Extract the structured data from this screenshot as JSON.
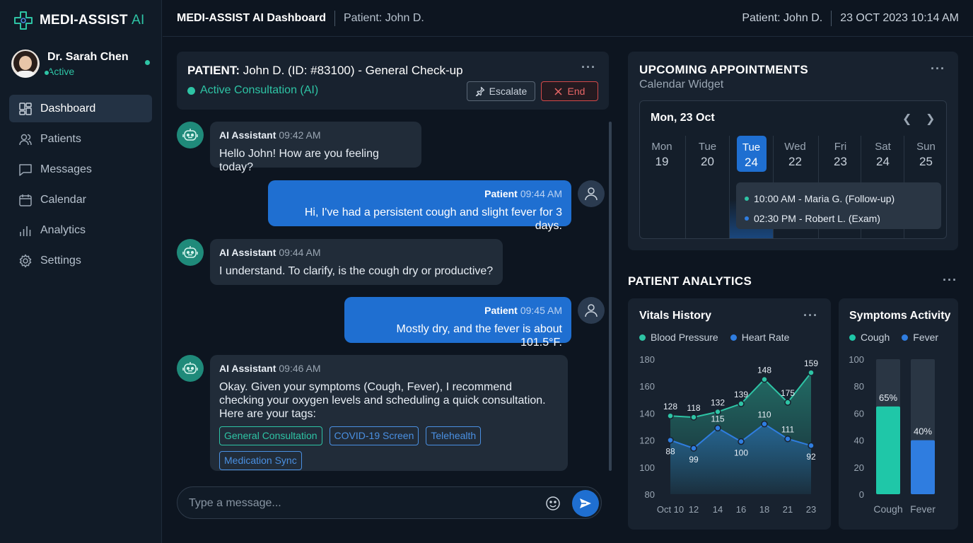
{
  "app": {
    "name": "MEDI-ASSIST",
    "name_suffix": "AI"
  },
  "user": {
    "name": "Dr. Sarah Chen",
    "status": "Active"
  },
  "nav": [
    {
      "label": "Dashboard",
      "icon": "dashboard-icon",
      "active": true
    },
    {
      "label": "Patients",
      "icon": "patients-icon"
    },
    {
      "label": "Messages",
      "icon": "messages-icon"
    },
    {
      "label": "Calendar",
      "icon": "calendar-icon"
    },
    {
      "label": "Analytics",
      "icon": "analytics-icon"
    },
    {
      "label": "Settings",
      "icon": "settings-icon"
    }
  ],
  "topbar": {
    "title": "MEDI-ASSIST AI Dashboard",
    "patient": "Patient: John D.",
    "right_patient": "Patient: John D.",
    "datetime": "23 OCT 2023 10:14 AM"
  },
  "chat": {
    "header_label": "PATIENT:",
    "header_title": "John D. (ID: #83100) - General Check-up",
    "status": "Active Consultation (AI)",
    "escalate_label": "Escalate",
    "end_label": "End",
    "messages": [
      {
        "sender": "AI Assistant",
        "time": "09:42 AM",
        "text": "Hello John! How are you feeling today?"
      },
      {
        "sender": "Patient",
        "time": "09:44 AM",
        "text": "Hi, I've had a persistent cough and slight fever for 3 days."
      },
      {
        "sender": "AI Assistant",
        "time": "09:44 AM",
        "text": "I understand. To clarify, is the cough dry or productive?"
      },
      {
        "sender": "Patient",
        "time": "09:45 AM",
        "text": "Mostly dry, and the fever is about 101.5°F."
      },
      {
        "sender": "AI Assistant",
        "time": "09:46 AM",
        "text": "Okay. Given your symptoms (Cough, Fever), I recommend checking your oxygen levels and scheduling a quick consultation. Here are your tags:"
      }
    ],
    "tags": [
      "General Consultation",
      "COVID-19 Screen",
      "Telehealth",
      "Medication Sync"
    ],
    "input_placeholder": "Type a message..."
  },
  "appointments": {
    "title": "UPCOMING APPOINTMENTS",
    "subtitle": "Calendar Widget",
    "current_date": "Mon, 23 Oct",
    "days": [
      {
        "name": "Mon",
        "num": "19"
      },
      {
        "name": "Tue",
        "num": "20"
      },
      {
        "name": "Tue",
        "num": "24",
        "selected": true
      },
      {
        "name": "Wed",
        "num": "22"
      },
      {
        "name": "Fri",
        "num": "23"
      },
      {
        "name": "Sat",
        "num": "24"
      },
      {
        "name": "Sun",
        "num": "25"
      }
    ],
    "events": [
      "10:00 AM - Maria G. (Follow-up)",
      "02:30 PM - Robert L. (Exam)"
    ]
  },
  "analytics": {
    "title": "PATIENT ANALYTICS",
    "vitals_title": "Vitals History",
    "symptoms_title": "Symptoms Activity"
  },
  "colors": {
    "teal": "#2ec4a5",
    "blue": "#1f6fd1",
    "danger": "#d44a4a"
  },
  "chart_data": [
    {
      "type": "area",
      "title": "Vitals History",
      "x": [
        "Oct 10",
        "12",
        "14",
        "16",
        "18",
        "21",
        "23"
      ],
      "ylim": [
        80,
        180
      ],
      "yticks": [
        80,
        100,
        120,
        140,
        160,
        180
      ],
      "series": [
        {
          "name": "Blood Pressure",
          "color": "#2ec4a5",
          "values": [
            128,
            118,
            132,
            139,
            148,
            175,
            159
          ],
          "labels": [
            "128",
            "118",
            "132",
            "139",
            "148",
            "175",
            "159"
          ],
          "y_plot": [
            138,
            137,
            141,
            147,
            165,
            148,
            170
          ]
        },
        {
          "name": "Heart Rate",
          "color": "#2f7de0",
          "values": [
            88,
            99,
            115,
            100,
            110,
            111,
            92
          ],
          "labels": [
            "88",
            "99",
            "115",
            "100",
            "110",
            "111",
            "92"
          ],
          "y_plot": [
            120,
            114,
            129,
            119,
            132,
            121,
            116
          ]
        }
      ],
      "legend": "top-left",
      "grid": false
    },
    {
      "type": "bar",
      "title": "Symptoms Activity",
      "categories": [
        "Cough",
        "Fever"
      ],
      "values": [
        65,
        40
      ],
      "value_labels": [
        "65%",
        "40%"
      ],
      "colors": [
        "#1fc7a8",
        "#2f7de0"
      ],
      "ylim": [
        0,
        100
      ],
      "yticks": [
        0,
        20,
        40,
        60,
        80,
        100
      ],
      "legend": "top-left"
    }
  ]
}
